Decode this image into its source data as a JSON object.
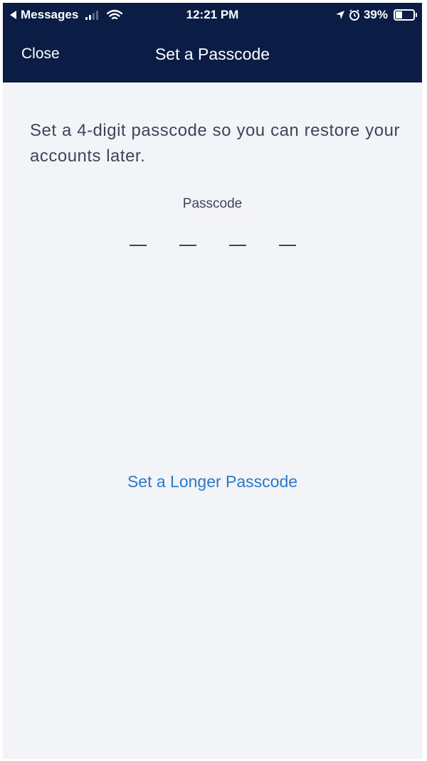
{
  "status_bar": {
    "back_app": "Messages",
    "time": "12:21 PM",
    "battery": "39%"
  },
  "nav": {
    "close_label": "Close",
    "title": "Set a Passcode"
  },
  "content": {
    "instructions": "Set a 4-digit passcode so you can restore your accounts later.",
    "passcode_label": "Passcode",
    "passcode_length": 4,
    "longer_link": "Set a Longer Passcode"
  },
  "colors": {
    "header_bg": "#0b1d44",
    "page_bg": "#f3f4f8",
    "text": "#3d4657",
    "link": "#2a78c8"
  },
  "icons": [
    "back-arrow-icon",
    "cell-signal-icon",
    "wifi-icon",
    "location-arrow-icon",
    "alarm-icon",
    "battery-icon"
  ]
}
